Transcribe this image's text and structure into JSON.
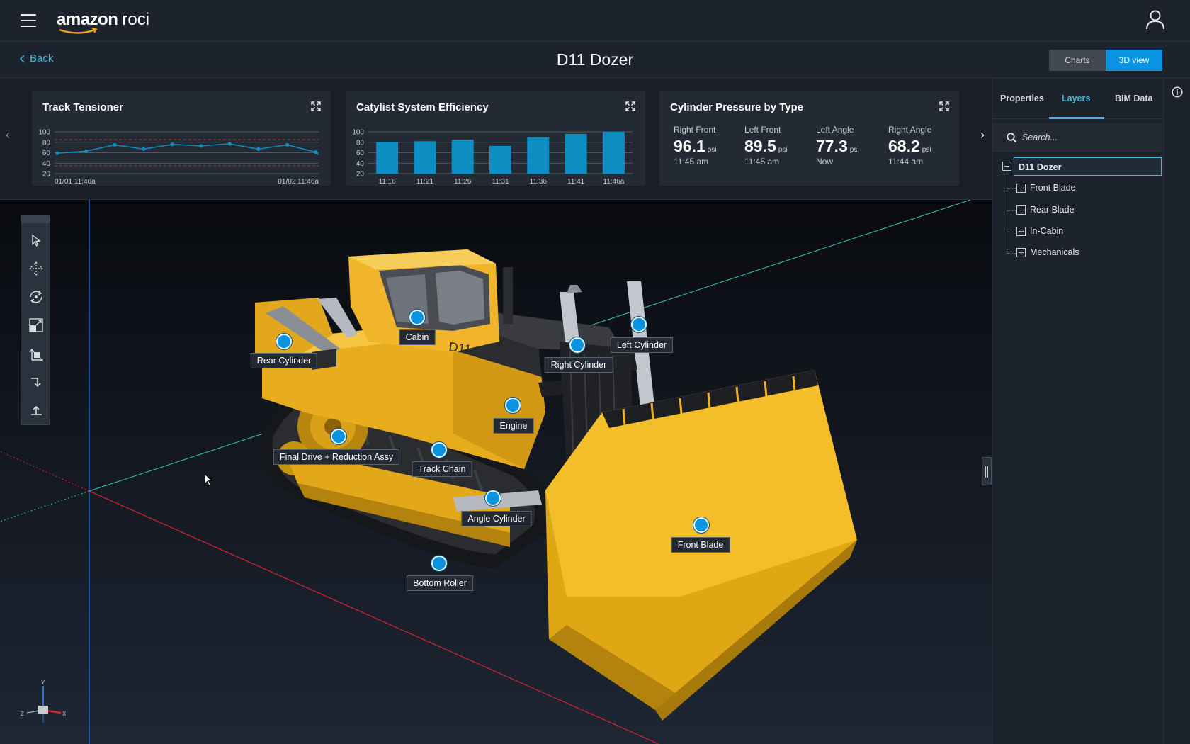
{
  "header": {
    "logo_brand": "amazon",
    "logo_product": "roci",
    "back_label": "Back",
    "page_title": "D11 Dozer",
    "view_toggle": {
      "charts": "Charts",
      "view3d": "3D view",
      "selected": "3D view"
    }
  },
  "cards": {
    "track_tensioner": {
      "title": "Track Tensioner",
      "chart_data": {
        "type": "line",
        "y_ticks": [
          "100",
          "80",
          "60",
          "40",
          "20"
        ],
        "ylim": [
          20,
          100
        ],
        "x_labels": [
          "01/01 11:46a",
          "01/02 11:46a"
        ],
        "values": [
          59,
          63,
          75,
          67,
          76,
          73,
          77,
          67,
          75,
          61
        ],
        "thresholds": [
          85,
          35
        ]
      }
    },
    "catalyst": {
      "title": "Catylist System Efficiency",
      "chart_data": {
        "type": "bar",
        "categories": [
          "11:16",
          "11:21",
          "11:26",
          "11:31",
          "11:36",
          "11:41",
          "11:46a"
        ],
        "values": [
          81,
          82,
          85,
          73,
          89,
          96,
          100
        ],
        "y_ticks": [
          "100",
          "80",
          "60",
          "40",
          "20"
        ],
        "ylim": [
          20,
          100
        ]
      }
    },
    "cylinder": {
      "title": "Cylinder Pressure by Type",
      "metrics": [
        {
          "label": "Right Front",
          "value": "96.1",
          "unit": "psi",
          "time": "11:45 am"
        },
        {
          "label": "Left Front",
          "value": "89.5",
          "unit": "psi",
          "time": "11:45 am"
        },
        {
          "label": "Left Angle",
          "value": "77.3",
          "unit": "psi",
          "time": "Now"
        },
        {
          "label": "Right Angle",
          "value": "68.2",
          "unit": "psi",
          "time": "11:44 am"
        }
      ]
    }
  },
  "panel": {
    "tabs": [
      "Properties",
      "Layers",
      "BIM Data"
    ],
    "active_tab": "Layers",
    "search_placeholder": "Search...",
    "tree": {
      "root": "D11 Dozer",
      "children": [
        "Front Blade",
        "Rear Blade",
        "In-Cabin",
        "Mechanicals"
      ]
    }
  },
  "hotspots": [
    {
      "label": "Cabin"
    },
    {
      "label": "Rear Cylinder"
    },
    {
      "label": "Right Cylinder"
    },
    {
      "label": "Left Cylinder"
    },
    {
      "label": "Engine"
    },
    {
      "label": "Final Drive + Reduction Assy"
    },
    {
      "label": "Track Chain"
    },
    {
      "label": "Angle Cylinder"
    },
    {
      "label": "Bottom Roller"
    },
    {
      "label": "Front Blade"
    }
  ],
  "axes_labels": {
    "x": "X",
    "y": "Y",
    "z": "Z"
  },
  "colors": {
    "accent": "#44b9d6",
    "button_blue": "#0a93e0",
    "dozer_yellow": "#f2b21b",
    "bar_blue": "#0e8fc4"
  }
}
